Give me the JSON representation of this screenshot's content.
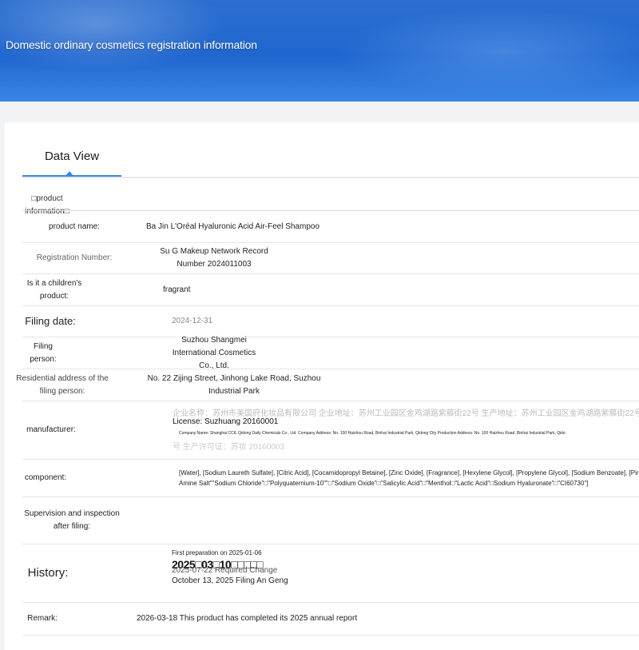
{
  "banner": {
    "title": "Domestic ordinary cosmetics registration information"
  },
  "tabs": [
    {
      "label": "Data View"
    }
  ],
  "section": {
    "label": "□product information□"
  },
  "rows": {
    "product_name": {
      "label": "product name:",
      "value": "Ba Jin L'Oréal Hyaluronic Acid Air-Feel Shampoo"
    },
    "registration": {
      "label": "Registration Number:",
      "value": "Su G Makeup Network Record Number 2024011003"
    },
    "children": {
      "label": "Is it a children's product:",
      "value": "fragrant"
    },
    "filing_date": {
      "label": "Filing date:",
      "value": "2024-12-31"
    },
    "filing_person": {
      "label": "Filing person:",
      "value": "Suzhou Shangmei International Cosmetics Co., Ltd."
    },
    "residential": {
      "label": "Residential address of the filing person:",
      "value": "No. 22 Zijing Street, Jinhong Lake Road, Suzhou Industrial Park"
    },
    "manufacturer": {
      "label": "manufacturer:",
      "cn_line": "企业名称：苏州市美国府化妆品有限公司 企业地址：苏州工业园区金鸡湖路紫藤街22号 生产地址：苏州工业园区金鸡湖路紫藤街22号 生产",
      "license": "License: Suzhuang 20160001",
      "en_line": "Company Name: Shanghai CCIL Qidong Daily Chemicals Co., Ltd. Company Address: No. 100 Haizhou Road, Binhai Industrial Park, Qidong City Production Address: No. 100 Haizhou Road, Binhai Industrial Park, Qido",
      "cn_line2": "号 生产许可证：苏妆 20160003"
    },
    "component": {
      "label": "component:",
      "line1": "[Water], [Sodium Laureth Sulfate], [Citric Acid], [Cocamidopropyl Betaine], [Zinc Oxide], [Fragrance], [Hexylene Glycol], [Propylene Glycol], [Sodium Benzoate], [Piroctone Olami",
      "line2": "Amine Salt\"\"Sodium Chloride\"□\"Polyquaternium-10\"\"□\"Sodium Oxide\"□\"Salicylic Acid\"□\"Menthol□\"Lactic Acid\"□Sodium Hyaluronate\"□\"CI60730\"]"
    },
    "supervision": {
      "label": "Supervision and inspection after filing:",
      "value": ""
    },
    "history": {
      "label": "History:",
      "line1": "First preparation on 2025-01-06",
      "line2": "2025□03□10□□□□□",
      "line3": "2025-07-22 Required Change",
      "line4": "October 13, 2025 Filing An Geng"
    },
    "remark": {
      "label": "Remark:",
      "value": "2026-03-18 This product has completed its 2025 annual report"
    }
  }
}
